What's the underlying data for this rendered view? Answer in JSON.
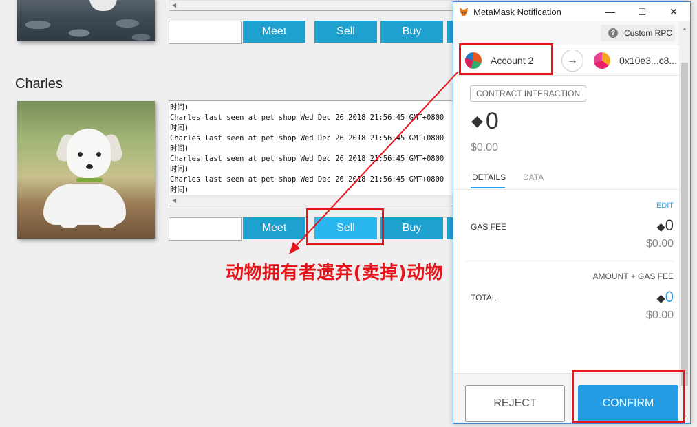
{
  "page": {
    "pets": [
      {
        "name": "",
        "actions": {
          "meet": "Meet",
          "sell": "Sell",
          "buy": "Buy"
        }
      },
      {
        "name": "Charles",
        "log_lines": [
          "时间)",
          "Charles last seen at pet shop Wed Dec 26 2018 21:56:45 GMT+0800",
          "时间)",
          "Charles last seen at pet shop Wed Dec 26 2018 21:56:45 GMT+0800",
          "时间)",
          "Charles last seen at pet shop Wed Dec 26 2018 21:56:45 GMT+0800",
          "时间)",
          "Charles last seen at pet shop Wed Dec 26 2018 21:56:45 GMT+0800",
          "时间)"
        ],
        "actions": {
          "meet": "Meet",
          "sell": "Sell",
          "buy": "Buy"
        }
      }
    ]
  },
  "annotation": {
    "caption": "动物拥有者遗弃(卖掉)动物",
    "color": "#e8141c"
  },
  "metamask": {
    "window_title": "MetaMask Notification",
    "network": "Custom RPC",
    "from_account": "Account 2",
    "to_address": "0x10e3...c8...",
    "badge": "CONTRACT INTERACTION",
    "amount": "0",
    "amount_fiat": "$0.00",
    "tabs": {
      "details": "DETAILS",
      "data": "DATA"
    },
    "edit": "EDIT",
    "gas_fee_label": "GAS FEE",
    "gas_fee": "0",
    "gas_fee_fiat": "$0.00",
    "total_sublabel": "AMOUNT + GAS FEE",
    "total_label": "TOTAL",
    "total": "0",
    "total_fiat": "$0.00",
    "reject": "REJECT",
    "confirm": "CONFIRM",
    "accent": "#259de4"
  }
}
